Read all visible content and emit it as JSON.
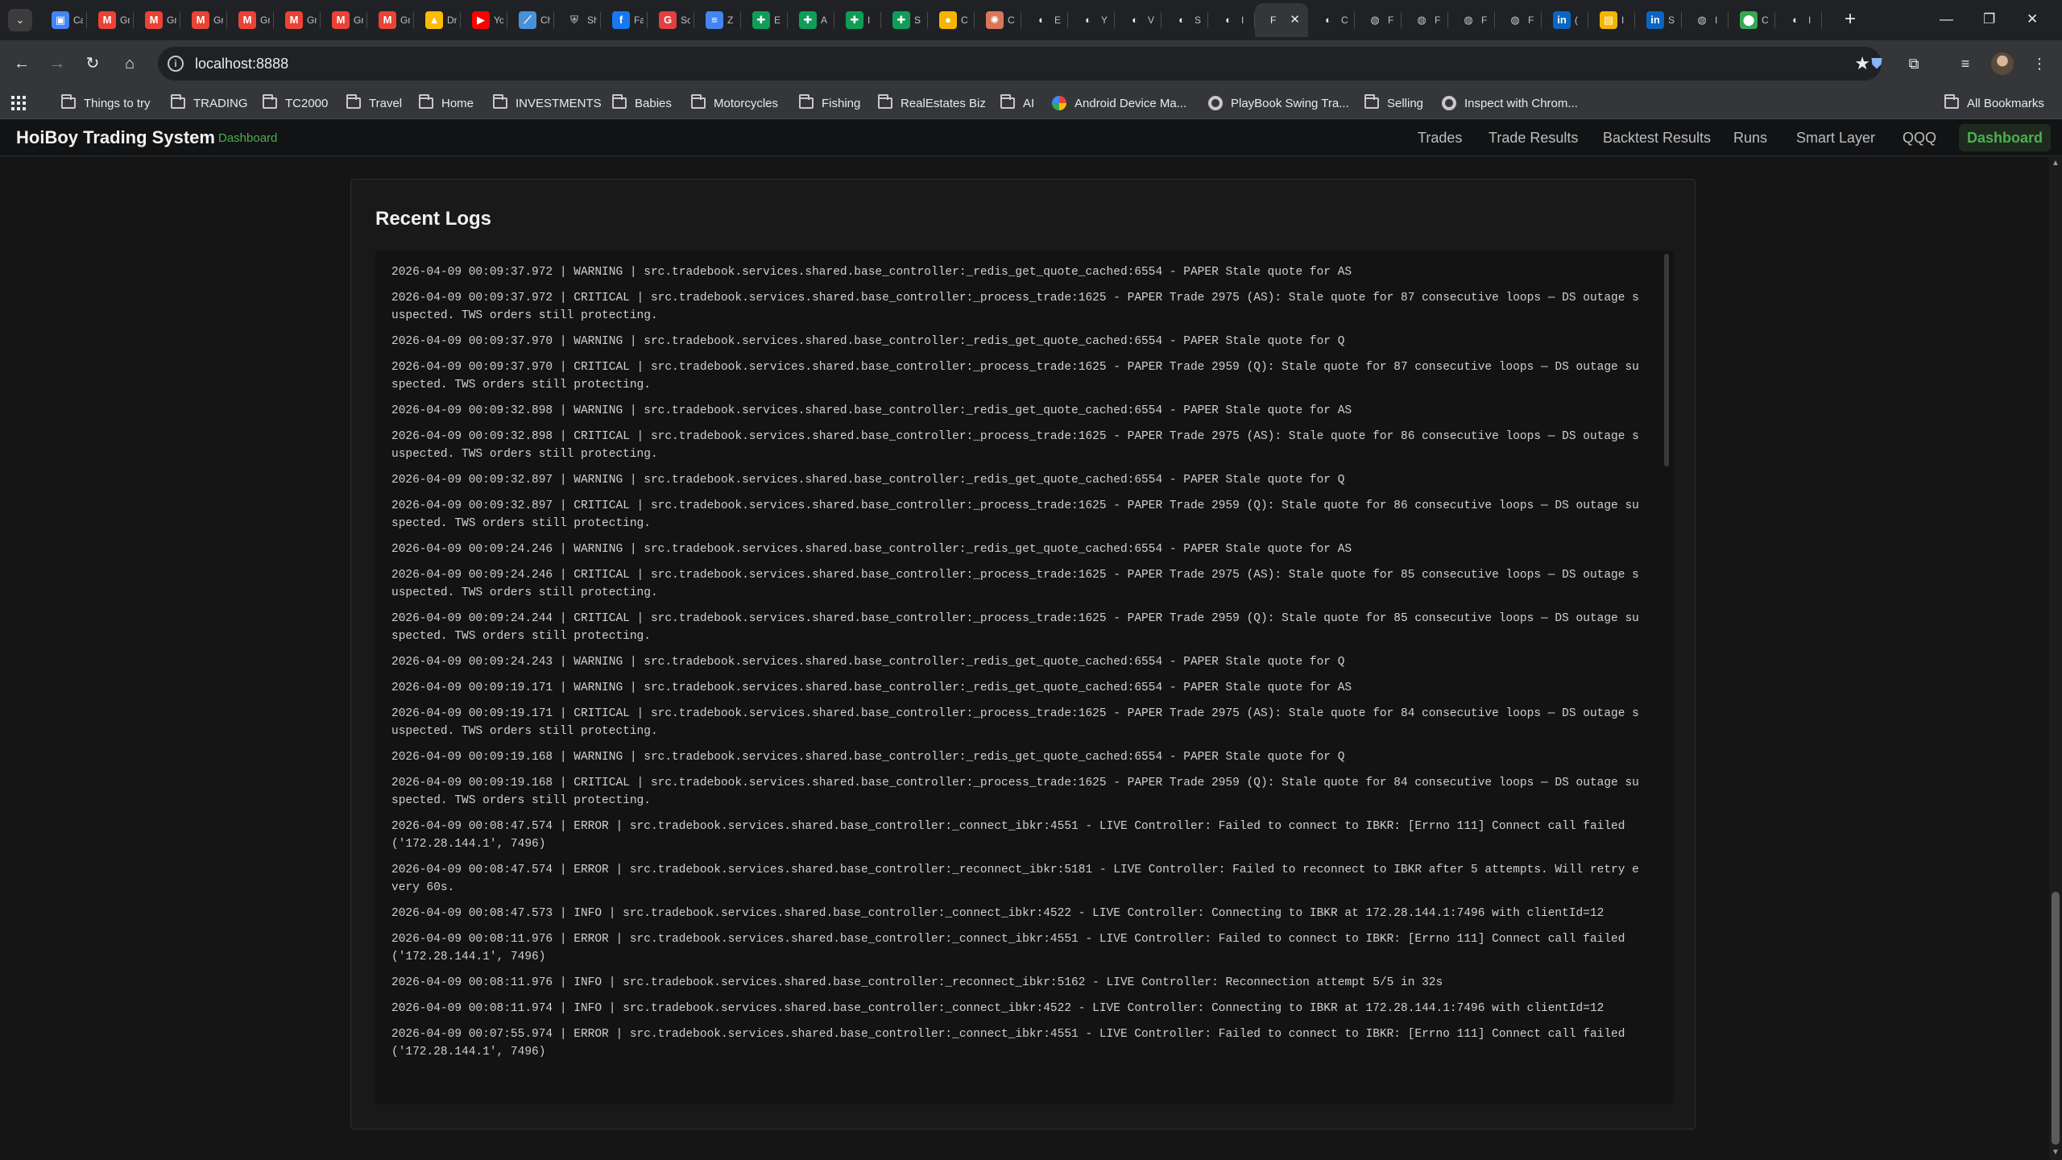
{
  "browser": {
    "tabs": [
      {
        "title": "Calendar",
        "icon": "calendar-icon",
        "color": "#4285f4",
        "glyph": "▣"
      },
      {
        "title": "Gmail",
        "icon": "gmail-icon",
        "color": "#ea4335",
        "glyph": "M"
      },
      {
        "title": "Gmail",
        "icon": "gmail-icon",
        "color": "#ea4335",
        "glyph": "M"
      },
      {
        "title": "Gmail",
        "icon": "gmail-icon",
        "color": "#ea4335",
        "glyph": "M"
      },
      {
        "title": "Gmail",
        "icon": "gmail-icon",
        "color": "#ea4335",
        "glyph": "M"
      },
      {
        "title": "Gmail",
        "icon": "gmail-icon",
        "color": "#ea4335",
        "glyph": "M"
      },
      {
        "title": "Gmail",
        "icon": "gmail-icon",
        "color": "#ea4335",
        "glyph": "M"
      },
      {
        "title": "Gmail",
        "icon": "gmail-icon",
        "color": "#ea4335",
        "glyph": "M"
      },
      {
        "title": "Drive",
        "icon": "drive-icon",
        "color": "#fbbc04",
        "glyph": "▲"
      },
      {
        "title": "YouTube",
        "icon": "youtube-icon",
        "color": "#ff0000",
        "glyph": "▶"
      },
      {
        "title": "Chart",
        "icon": "chart-icon",
        "color": "#4a90d9",
        "glyph": "⟋"
      },
      {
        "title": "Shield",
        "icon": "shield-icon",
        "color": "#9e9e9e",
        "glyph": "⛨"
      },
      {
        "title": "Facebook",
        "icon": "facebook-icon",
        "color": "#1877f2",
        "glyph": "f"
      },
      {
        "title": "Screener",
        "icon": "screener-icon",
        "color": "#e04040",
        "glyph": "G"
      },
      {
        "title": "Z",
        "icon": "docs-icon",
        "color": "#4285f4",
        "glyph": "≡"
      },
      {
        "title": "E",
        "icon": "sheets-icon",
        "color": "#0f9d58",
        "glyph": "✚"
      },
      {
        "title": "A",
        "icon": "sheets-icon",
        "color": "#0f9d58",
        "glyph": "✚"
      },
      {
        "title": "I",
        "icon": "sheets-icon",
        "color": "#0f9d58",
        "glyph": "✚"
      },
      {
        "title": "S",
        "icon": "sheets-icon",
        "color": "#0f9d58",
        "glyph": "✚"
      },
      {
        "title": "C",
        "icon": "coin-icon",
        "color": "#f4b400",
        "glyph": "●"
      },
      {
        "title": "C",
        "icon": "claude-icon",
        "color": "#d97757",
        "glyph": "✺"
      },
      {
        "title": "E",
        "icon": "github-icon",
        "color": "#e8eaed",
        "glyph": "◐"
      },
      {
        "title": "Y",
        "icon": "github-icon",
        "color": "#e8eaed",
        "glyph": "◐"
      },
      {
        "title": "V",
        "icon": "github-icon",
        "color": "#e8eaed",
        "glyph": "◐"
      },
      {
        "title": "S",
        "icon": "github-icon",
        "color": "#e8eaed",
        "glyph": "◐"
      },
      {
        "title": "I",
        "icon": "github-icon",
        "color": "#e8eaed",
        "glyph": "◐"
      },
      {
        "title": "C",
        "icon": "github-icon",
        "color": "#e8eaed",
        "glyph": "◐"
      },
      {
        "title": "F",
        "icon": "globe-icon",
        "color": "#c8c8c8",
        "glyph": "◍"
      },
      {
        "title": "F",
        "icon": "globe-icon",
        "color": "#c8c8c8",
        "glyph": "◍"
      },
      {
        "title": "F",
        "icon": "globe-icon",
        "color": "#c8c8c8",
        "glyph": "◍"
      },
      {
        "title": "F",
        "icon": "globe-icon",
        "color": "#c8c8c8",
        "glyph": "◍"
      },
      {
        "title": "(",
        "icon": "linkedin-icon",
        "color": "#0a66c2",
        "glyph": "in"
      },
      {
        "title": "I",
        "icon": "stripes-icon",
        "color": "#f4b400",
        "glyph": "▤"
      },
      {
        "title": "S",
        "icon": "linkedin-icon",
        "color": "#0a66c2",
        "glyph": "in"
      },
      {
        "title": "I",
        "icon": "globe-icon",
        "color": "#c8c8c8",
        "glyph": "◍"
      },
      {
        "title": "C",
        "icon": "maps-icon",
        "color": "#34a853",
        "glyph": "⬤"
      },
      {
        "title": "I",
        "icon": "github-icon",
        "color": "#e8eaed",
        "glyph": "◐"
      }
    ],
    "active_tab_index": 26,
    "active_tab": {
      "title": "F",
      "icon": "globe-icon"
    },
    "url": "localhost:8888",
    "bookmarks": [
      "Things to try",
      "TRADING",
      "TC2000",
      "Travel",
      "Home",
      "INVESTMENTS",
      "Babies",
      "Motorcycles",
      "Fishing",
      "RealEstates Biz",
      "AI",
      "Android Device Ma...",
      "PlayBook Swing Tra...",
      "Selling",
      "Inspect with Chrom..."
    ],
    "all_bookmarks": "All Bookmarks"
  },
  "app": {
    "brand": "HoiBoy Trading System",
    "brand_sub": "Dashboard",
    "nav": [
      "Trades",
      "Trade Results",
      "Backtest Results",
      "Runs",
      "Smart Layer",
      "QQQ",
      "Dashboard"
    ],
    "active_nav": "Dashboard",
    "accent_color": "#4caf50"
  },
  "logs": {
    "title": "Recent Logs",
    "lines": [
      "2026-04-09 00:09:37.972 | WARNING | src.tradebook.services.shared.base_controller:_redis_get_quote_cached:6554 - PAPER Stale quote for AS",
      "2026-04-09 00:09:37.972 | CRITICAL | src.tradebook.services.shared.base_controller:_process_trade:1625 - PAPER Trade 2975 (AS): Stale quote for 87 consecutive loops — DS outage suspected. TWS orders still protecting.",
      "2026-04-09 00:09:37.970 | WARNING | src.tradebook.services.shared.base_controller:_redis_get_quote_cached:6554 - PAPER Stale quote for Q",
      "2026-04-09 00:09:37.970 | CRITICAL | src.tradebook.services.shared.base_controller:_process_trade:1625 - PAPER Trade 2959 (Q): Stale quote for 87 consecutive loops — DS outage suspected. TWS orders still protecting.",
      "2026-04-09 00:09:32.898 | WARNING | src.tradebook.services.shared.base_controller:_redis_get_quote_cached:6554 - PAPER Stale quote for AS",
      "2026-04-09 00:09:32.898 | CRITICAL | src.tradebook.services.shared.base_controller:_process_trade:1625 - PAPER Trade 2975 (AS): Stale quote for 86 consecutive loops — DS outage suspected. TWS orders still protecting.",
      "2026-04-09 00:09:32.897 | WARNING | src.tradebook.services.shared.base_controller:_redis_get_quote_cached:6554 - PAPER Stale quote for Q",
      "2026-04-09 00:09:32.897 | CRITICAL | src.tradebook.services.shared.base_controller:_process_trade:1625 - PAPER Trade 2959 (Q): Stale quote for 86 consecutive loops — DS outage suspected. TWS orders still protecting.",
      "2026-04-09 00:09:24.246 | WARNING | src.tradebook.services.shared.base_controller:_redis_get_quote_cached:6554 - PAPER Stale quote for AS",
      "2026-04-09 00:09:24.246 | CRITICAL | src.tradebook.services.shared.base_controller:_process_trade:1625 - PAPER Trade 2975 (AS): Stale quote for 85 consecutive loops — DS outage suspected. TWS orders still protecting.",
      "2026-04-09 00:09:24.244 | CRITICAL | src.tradebook.services.shared.base_controller:_process_trade:1625 - PAPER Trade 2959 (Q): Stale quote for 85 consecutive loops — DS outage suspected. TWS orders still protecting.",
      "2026-04-09 00:09:24.243 | WARNING | src.tradebook.services.shared.base_controller:_redis_get_quote_cached:6554 - PAPER Stale quote for Q",
      "2026-04-09 00:09:19.171 | WARNING | src.tradebook.services.shared.base_controller:_redis_get_quote_cached:6554 - PAPER Stale quote for AS",
      "2026-04-09 00:09:19.171 | CRITICAL | src.tradebook.services.shared.base_controller:_process_trade:1625 - PAPER Trade 2975 (AS): Stale quote for 84 consecutive loops — DS outage suspected. TWS orders still protecting.",
      "2026-04-09 00:09:19.168 | WARNING | src.tradebook.services.shared.base_controller:_redis_get_quote_cached:6554 - PAPER Stale quote for Q",
      "2026-04-09 00:09:19.168 | CRITICAL | src.tradebook.services.shared.base_controller:_process_trade:1625 - PAPER Trade 2959 (Q): Stale quote for 84 consecutive loops — DS outage suspected. TWS orders still protecting.",
      "2026-04-09 00:08:47.574 | ERROR | src.tradebook.services.shared.base_controller:_connect_ibkr:4551 - LIVE Controller: Failed to connect to IBKR: [Errno 111] Connect call failed ('172.28.144.1', 7496)",
      "2026-04-09 00:08:47.574 | ERROR | src.tradebook.services.shared.base_controller:_reconnect_ibkr:5181 - LIVE Controller: Failed to reconnect to IBKR after 5 attempts. Will retry every 60s.",
      "2026-04-09 00:08:47.573 | INFO | src.tradebook.services.shared.base_controller:_connect_ibkr:4522 - LIVE Controller: Connecting to IBKR at 172.28.144.1:7496 with clientId=12",
      "2026-04-09 00:08:11.976 | ERROR | src.tradebook.services.shared.base_controller:_connect_ibkr:4551 - LIVE Controller: Failed to connect to IBKR: [Errno 111] Connect call failed ('172.28.144.1', 7496)",
      "2026-04-09 00:08:11.976 | INFO | src.tradebook.services.shared.base_controller:_reconnect_ibkr:5162 - LIVE Controller: Reconnection attempt 5/5 in 32s",
      "2026-04-09 00:08:11.974 | INFO | src.tradebook.services.shared.base_controller:_connect_ibkr:4522 - LIVE Controller: Connecting to IBKR at 172.28.144.1:7496 with clientId=12",
      "2026-04-09 00:07:55.974 | ERROR | src.tradebook.services.shared.base_controller:_connect_ibkr:4551 - LIVE Controller: Failed to connect to IBKR: [Errno 111] Connect call failed ('172.28.144.1', 7496)"
    ]
  }
}
